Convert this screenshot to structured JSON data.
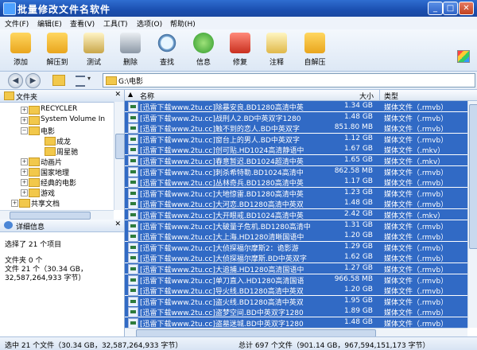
{
  "window": {
    "title": "批量修改文件名软件"
  },
  "menu": [
    "文件(F)",
    "编辑(E)",
    "查看(V)",
    "工具(T)",
    "选项(O)",
    "帮助(H)"
  ],
  "toolbar": [
    {
      "label": "添加",
      "icon": "add-folder-icon"
    },
    {
      "label": "解压到",
      "icon": "extract-folder-icon"
    },
    {
      "label": "测试",
      "icon": "test-clipboard-icon"
    },
    {
      "label": "删除",
      "icon": "trash-icon"
    },
    {
      "label": "查找",
      "icon": "magnifier-icon"
    },
    {
      "label": "信息",
      "icon": "info-icon"
    },
    {
      "label": "修复",
      "icon": "repair-kit-icon"
    },
    {
      "label": "注释",
      "icon": "comment-icon"
    },
    {
      "label": "自解压",
      "icon": "self-extract-icon"
    }
  ],
  "address": {
    "path": "G:\\电影"
  },
  "left": {
    "folders_title": "文件夹",
    "tree": [
      {
        "label": "RECYCLER",
        "level": 2,
        "expand": "+"
      },
      {
        "label": "System Volume In",
        "level": 2,
        "expand": "+"
      },
      {
        "label": "电影",
        "level": 2,
        "expand": "−"
      },
      {
        "label": "成龙",
        "level": 3,
        "expand": ""
      },
      {
        "label": "周星驰",
        "level": 3,
        "expand": ""
      },
      {
        "label": "动画片",
        "level": 2,
        "expand": "+"
      },
      {
        "label": "国家地理",
        "level": 2,
        "expand": "+"
      },
      {
        "label": "经典的电影",
        "level": 2,
        "expand": "+"
      },
      {
        "label": "游戏",
        "level": 2,
        "expand": "+"
      },
      {
        "label": "共享文档",
        "level": 1,
        "expand": "+"
      }
    ],
    "details_title": "详细信息",
    "details": {
      "selected": "选择了 21 个项目",
      "folders": "文件夹 0 个",
      "files_line1": "文件 21 个（30.34 GB，",
      "files_line2": "32,587,264,933 字节）"
    }
  },
  "list": {
    "headers": {
      "name": "名称",
      "size": "大小",
      "type": "类型"
    },
    "rows": [
      {
        "name": "[迅雷下载www.2tu.cc]除暴安良.BD1280高清中英",
        "size": "1.34 GB",
        "type": "媒体文件（.rmvb）"
      },
      {
        "name": "[迅雷下载www.2tu.cc]战刑人2.BD中英双字1280",
        "size": "1.48 GB",
        "type": "媒体文件（.rmvb）"
      },
      {
        "name": "[迅雷下载www.2tu.cc]触不到的恋人.BD中英双字",
        "size": "851.80 MB",
        "type": "媒体文件（.rmvb）"
      },
      {
        "name": "[迅雷下载www.2tu.cc]窗台上的男人.BD中英双字",
        "size": "1.12 GB",
        "type": "媒体文件（.rmvb）"
      },
      {
        "name": "[迅雷下载www.2tu.cc]创可贴.HD1024高清静语中",
        "size": "1.67 GB",
        "type": "媒体文件（.mkv）"
      },
      {
        "name": "[迅雷下载www.2tu.cc]春意暂迟.BD1024超清中英",
        "size": "1.65 GB",
        "type": "媒体文件（.mkv）"
      },
      {
        "name": "[迅雷下载www.2tu.cc]刺杀希特勒.BD1024高清中",
        "size": "862.58 MB",
        "type": "媒体文件（.rmvb）"
      },
      {
        "name": "[迅雷下载www.2tu.cc]丛林奇兵.BD1280高清中英",
        "size": "1.17 GB",
        "type": "媒体文件（.rmvb）"
      },
      {
        "name": "[迅雷下载www.2tu.cc]大地惊雷.BD1280高清中英",
        "size": "1.23 GB",
        "type": "媒体文件（.rmvb）"
      },
      {
        "name": "[迅雷下载www.2tu.cc]大河恋.BD1280高清中英双",
        "size": "1.48 GB",
        "type": "媒体文件（.rmvb）"
      },
      {
        "name": "[迅雷下载www.2tu.cc]大开眼戒.BD1024高清中英",
        "size": "2.42 GB",
        "type": "媒体文件（.mkv）"
      },
      {
        "name": "[迅雷下载www.2tu.cc]大破量子危机.BD1280高清中",
        "size": "1.31 GB",
        "type": "媒体文件（.rmvb）"
      },
      {
        "name": "[迅雷下载www.2tu.cc]大上海.HD1280清晰国语中",
        "size": "1.20 GB",
        "type": "媒体文件（.rmvb）"
      },
      {
        "name": "[迅雷下载www.2tu.cc]大侦探福尔摩斯2：诡影游",
        "size": "1.29 GB",
        "type": "媒体文件（.rmvb）"
      },
      {
        "name": "[迅雷下载www.2tu.cc]大侦探福尔摩斯.BD中英双字",
        "size": "1.62 GB",
        "type": "媒体文件（.rmvb）"
      },
      {
        "name": "[迅雷下载www.2tu.cc]大追捕.HD1280高清国语中",
        "size": "1.27 GB",
        "type": "媒体文件（.rmvb）"
      },
      {
        "name": "[迅雷下载www.2tu.cc]单刀直入.HD1280高清国语",
        "size": "966.58 MB",
        "type": "媒体文件（.rmvb）"
      },
      {
        "name": "[迅雷下载www.2tu.cc]导火线.BD1280高清中英双",
        "size": "1.20 GB",
        "type": "媒体文件（.rmvb）"
      },
      {
        "name": "[迅雷下载www.2tu.cc]盗火线.BD1280高清中英双",
        "size": "1.95 GB",
        "type": "媒体文件（.rmvb）"
      },
      {
        "name": "[迅雷下载www.2tu.cc]盗梦空间.BD中英双字1280",
        "size": "1.89 GB",
        "type": "媒体文件（.rmvb）"
      },
      {
        "name": "[迅雷下载www.2tu.cc]盗墓迷城.BD中英双字1280",
        "size": "1.48 GB",
        "type": "媒体文件（.rmvb）"
      }
    ]
  },
  "status": {
    "left": "选中 21 个文件（30.34 GB，32,587,264,933 字节）",
    "right": "总计 697 个文件（901.14 GB，967,594,151,173 字节）"
  },
  "colors": {
    "selection": "#316ac5",
    "title_bar": "#1b4fb0"
  }
}
